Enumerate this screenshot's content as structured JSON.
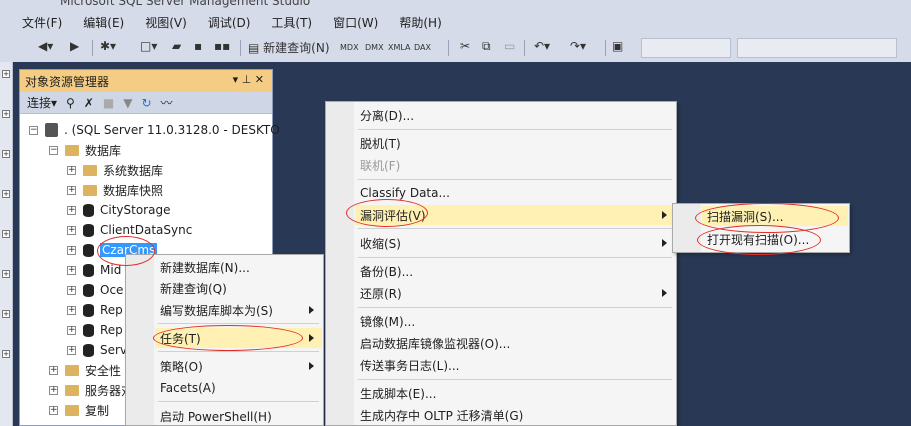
{
  "window": {
    "title": "Microsoft SQL Server Management Studio"
  },
  "menubar": [
    "文件(F)",
    "编辑(E)",
    "视图(V)",
    "调试(D)",
    "工具(T)",
    "窗口(W)",
    "帮助(H)"
  ],
  "toolbar": {
    "new_query": "新建查询(N)",
    "mdx": "MDX",
    "dmx": "DMX",
    "xmla": "XMLA",
    "dax": "DAX"
  },
  "object_explorer": {
    "title": "对象资源管理器",
    "pin_glyph": "▾ ⊥ ✕",
    "connect_label": "连接▾",
    "tree": {
      "server": ". (SQL Server 11.0.3128.0 - DESKTO",
      "databases_label": "数据库",
      "system_dbs": "系统数据库",
      "snapshots": "数据库快照",
      "dbs": [
        "CityStorage",
        "ClientDataSync",
        "CzarCms",
        "Mid",
        "Oce",
        "Rep",
        "Rep",
        "Serv"
      ],
      "security": "安全性",
      "server_objects": "服务器对",
      "replication": "复制"
    }
  },
  "db_context_menu": {
    "items": [
      "新建数据库(N)...",
      "新建查询(Q)",
      "编写数据库脚本为(S)",
      "任务(T)",
      "策略(O)",
      "Facets(A)",
      "启动 PowerShell(H)"
    ]
  },
  "tasks_menu": {
    "items": [
      "分离(D)...",
      "脱机(T)",
      "联机(F)",
      "Classify Data...",
      "漏洞评估(V)",
      "收缩(S)",
      "备份(B)...",
      "还原(R)",
      "镜像(M)...",
      "启动数据库镜像监视器(O)...",
      "传送事务日志(L)...",
      "生成脚本(E)...",
      "生成内存中 OLTP 迁移清单(G)"
    ]
  },
  "va_menu": {
    "items": [
      "扫描漏洞(S)...",
      "打开现有扫描(O)..."
    ]
  },
  "colors": {
    "highlight": "#fff1b3",
    "annotation": "#e0302a",
    "selection": "#3399ff"
  }
}
